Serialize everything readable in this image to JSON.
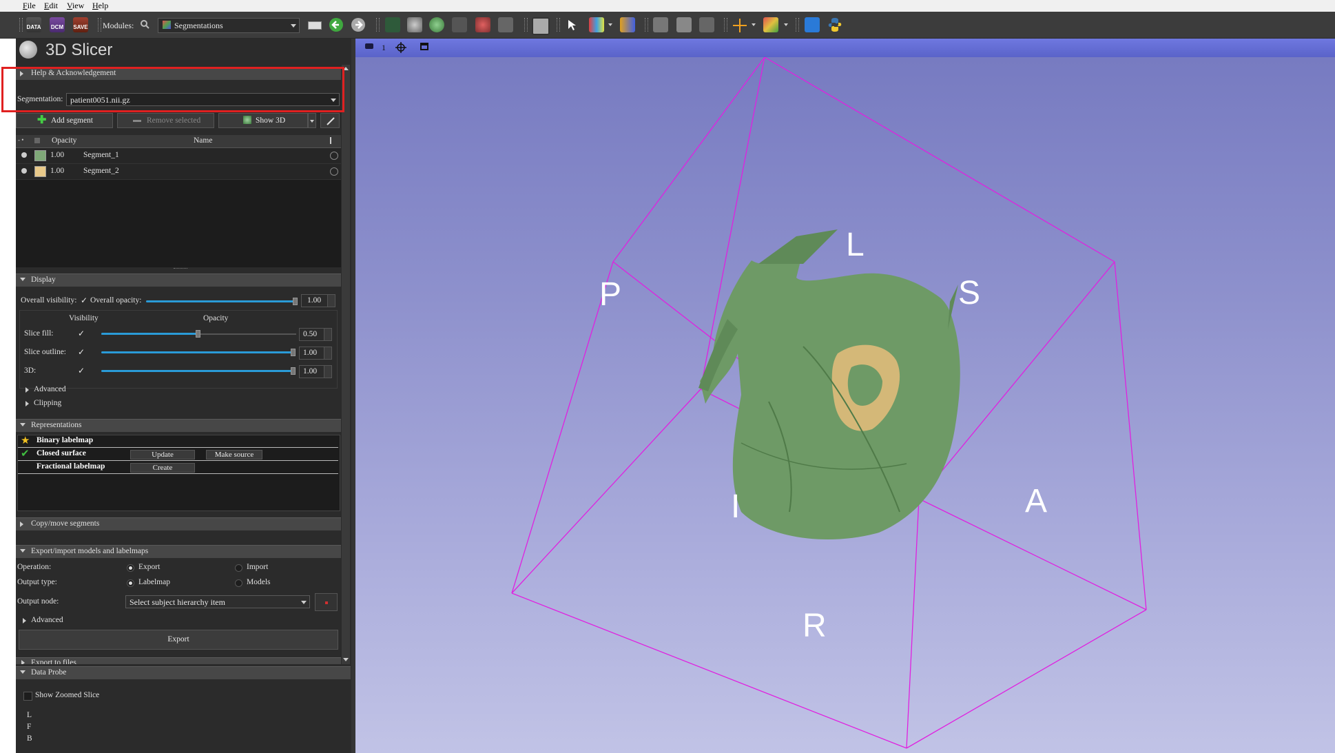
{
  "menu": [
    "File",
    "Edit",
    "View",
    "Help"
  ],
  "toolbar": {
    "data_label": "DATA",
    "dcm_label": "DCM",
    "save_label": "SAVE",
    "modules_label": "Modules:",
    "module_selected": "Segmentations"
  },
  "app": {
    "name": "3D Slicer"
  },
  "sections": {
    "help": "Help & Acknowledgement",
    "display": "Display",
    "representations": "Representations",
    "copy_move": "Copy/move segments",
    "export_import": "Export/import models and labelmaps",
    "export_files": "Export to files",
    "data_probe": "Data Probe"
  },
  "segmentation": {
    "label": "Segmentation:",
    "value": "patient0051.nii.gz"
  },
  "segment_buttons": {
    "add": "Add segment",
    "remove": "Remove selected",
    "show3d": "Show 3D"
  },
  "table": {
    "col_opacity": "Opacity",
    "col_name": "Name",
    "rows": [
      {
        "opacity": "1.00",
        "name": "Segment_1",
        "color": "#7fa878"
      },
      {
        "opacity": "1.00",
        "name": "Segment_2",
        "color": "#e8c98a"
      }
    ]
  },
  "display": {
    "overall_visibility": "Overall visibility:",
    "overall_opacity": "Overall opacity:",
    "overall_opacity_value": "1.00",
    "col_visibility": "Visibility",
    "col_opacity": "Opacity",
    "slice_fill": "Slice fill:",
    "slice_fill_value": "0.50",
    "slice_outline": "Slice outline:",
    "slice_outline_value": "1.00",
    "three_d": "3D:",
    "three_d_value": "1.00",
    "advanced": "Advanced",
    "clipping": "Clipping"
  },
  "representations": {
    "binary": "Binary labelmap",
    "closed": "Closed surface",
    "fractional": "Fractional labelmap",
    "update": "Update",
    "make_source": "Make source",
    "create": "Create"
  },
  "export": {
    "operation": "Operation:",
    "export_opt": "Export",
    "import_opt": "Import",
    "output_type": "Output type:",
    "labelmap_opt": "Labelmap",
    "models_opt": "Models",
    "output_node": "Output node:",
    "output_node_value": "Select subject hierarchy item",
    "advanced": "Advanced",
    "export_button": "Export"
  },
  "data_probe": {
    "show_zoomed": "Show Zoomed Slice",
    "l": "L",
    "f": "F",
    "b": "B"
  },
  "viewer": {
    "view_number": "1",
    "labels": {
      "L": "L",
      "S": "S",
      "P": "P",
      "A": "A",
      "R": "R",
      "I": "I"
    },
    "box_color": "#e020e0",
    "segment_color": "#6e9a66"
  }
}
